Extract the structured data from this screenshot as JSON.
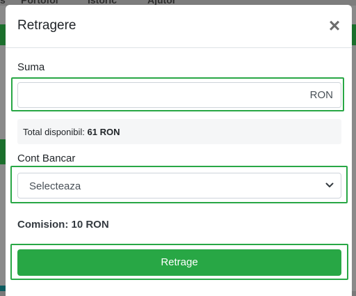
{
  "background": {
    "nav_items": [
      "s",
      "Portofol",
      "Istoric",
      "Ajutor"
    ]
  },
  "modal": {
    "title": "Retragere",
    "close_symbol": "×",
    "amount": {
      "label": "Suma",
      "value": "",
      "suffix": "RON"
    },
    "available": {
      "prefix": "Total disponibil:",
      "value": "61 RON"
    },
    "bank_account": {
      "label": "Cont Bancar",
      "selected": "Selecteaza"
    },
    "commission": "Comision: 10 RON",
    "submit_label": "Retrage",
    "colors": {
      "accent": "#28a745",
      "overlay": "#8a8a8a"
    }
  }
}
